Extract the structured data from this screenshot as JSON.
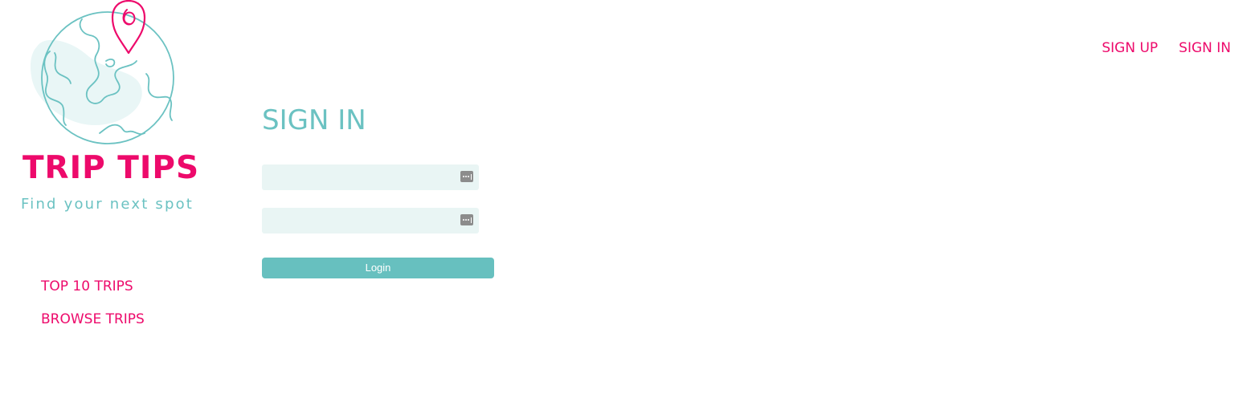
{
  "brand": {
    "name": "TRIP TIPS",
    "tagline": "Find your next spot"
  },
  "top_nav": {
    "sign_up": "SIGN UP",
    "sign_in": "SIGN IN"
  },
  "side_nav": {
    "items": [
      {
        "label": "TOP 10 TRIPS"
      },
      {
        "label": "BROWSE TRIPS"
      }
    ]
  },
  "form": {
    "heading": "SIGN IN",
    "username": {
      "value": "",
      "placeholder": ""
    },
    "password": {
      "value": "",
      "placeholder": ""
    },
    "submit_label": "Login"
  },
  "icons": {
    "logo": "globe-with-map-pin-icon",
    "field_autofill": "password-manager-key-icon"
  },
  "colors": {
    "accent": "#ed0a6b",
    "teal": "#6bc2c2",
    "field_background": "#e9f5f4",
    "button": "#67c0bf"
  }
}
